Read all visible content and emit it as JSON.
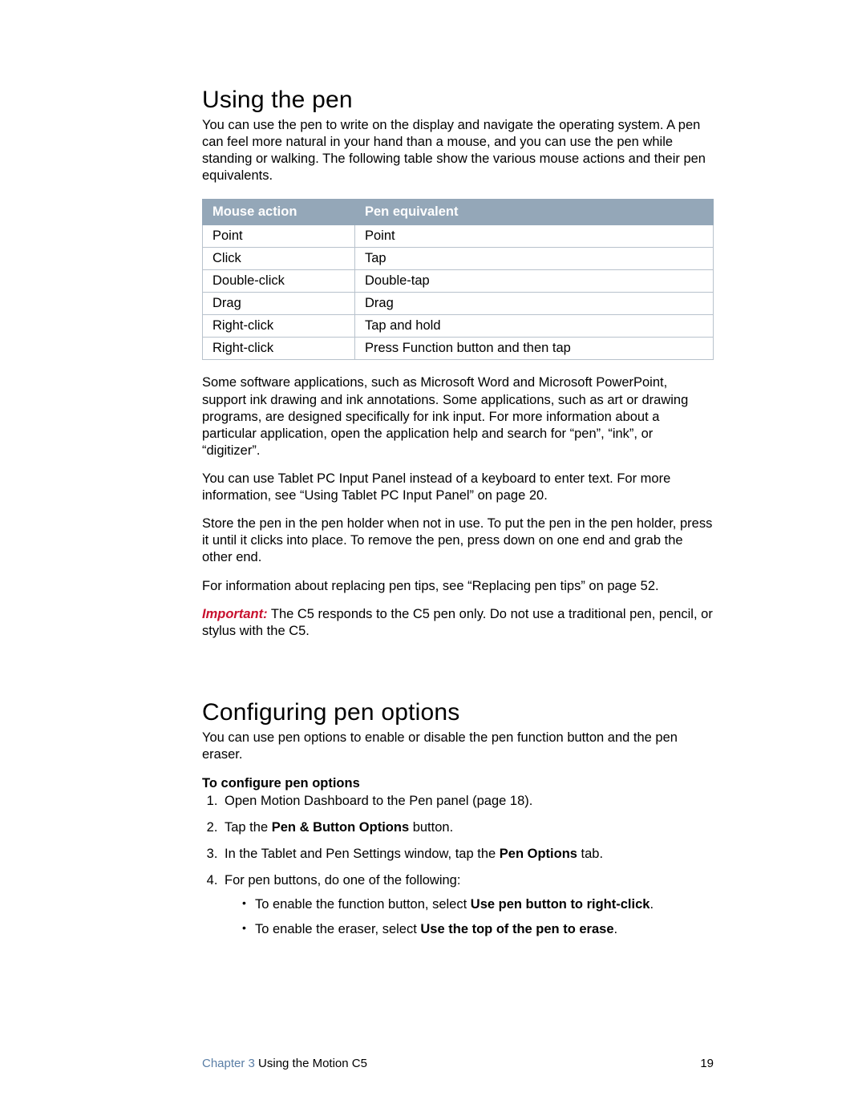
{
  "section1": {
    "heading": "Using the pen",
    "intro": "You can use the pen to write on the display and navigate the operating system. A pen can feel more natural in your hand than a mouse, and you can use the pen while standing or walking. The following table show the various mouse actions and their pen equivalents.",
    "table": {
      "headers": [
        "Mouse action",
        "Pen equivalent"
      ],
      "rows": [
        [
          "Point",
          "Point"
        ],
        [
          "Click",
          "Tap"
        ],
        [
          "Double-click",
          "Double-tap"
        ],
        [
          "Drag",
          "Drag"
        ],
        [
          "Right-click",
          "Tap and hold"
        ],
        [
          "Right-click",
          "Press Function button and then tap"
        ]
      ]
    },
    "p_after_table": "Some software applications, such as Microsoft Word and Microsoft PowerPoint, support ink drawing and ink annotations. Some applications, such as art or drawing programs, are designed specifically for ink input. For more information about a particular application, open the application help and search for “pen”, “ink”, or “digitizer”.",
    "p_input_panel": "You can use Tablet PC Input Panel instead of a keyboard to enter text. For more information, see “Using Tablet PC Input Panel” on page 20.",
    "p_store": "Store the pen in the pen holder when not in use. To put the pen in the pen holder, press it until it clicks into place. To remove the pen, press down on one end and grab the other end.",
    "p_replace_tips": "For information about replacing pen tips, see “Replacing pen tips” on page 52.",
    "important_label": "Important:",
    "important_text": " The C5 responds to the C5 pen only. Do not use a traditional pen, pencil, or stylus with the C5."
  },
  "section2": {
    "heading": "Configuring pen options",
    "intro": "You can use pen options to enable or disable the pen function button and the pen eraser.",
    "sub_heading": "To configure pen options",
    "steps": {
      "s1": "Open Motion Dashboard to the Pen panel (page 18).",
      "s2a": "Tap the ",
      "s2b_bold": "Pen & Button Options",
      "s2c": " button.",
      "s3a": "In the Tablet and Pen Settings window, tap the ",
      "s3b_bold": "Pen Options",
      "s3c": " tab.",
      "s4_lead": "For pen buttons, do one of the following:",
      "s4_b1a": "To enable the function button, select ",
      "s4_b1b_bold": "Use pen button to right-click",
      "s4_b1c": ".",
      "s4_b2a": "To enable the eraser, select ",
      "s4_b2b_bold": "Use the top of the pen to erase",
      "s4_b2c": "."
    }
  },
  "footer": {
    "chapter_label": "Chapter 3",
    "chapter_title": "  Using the Motion C5",
    "page_number": "19"
  }
}
